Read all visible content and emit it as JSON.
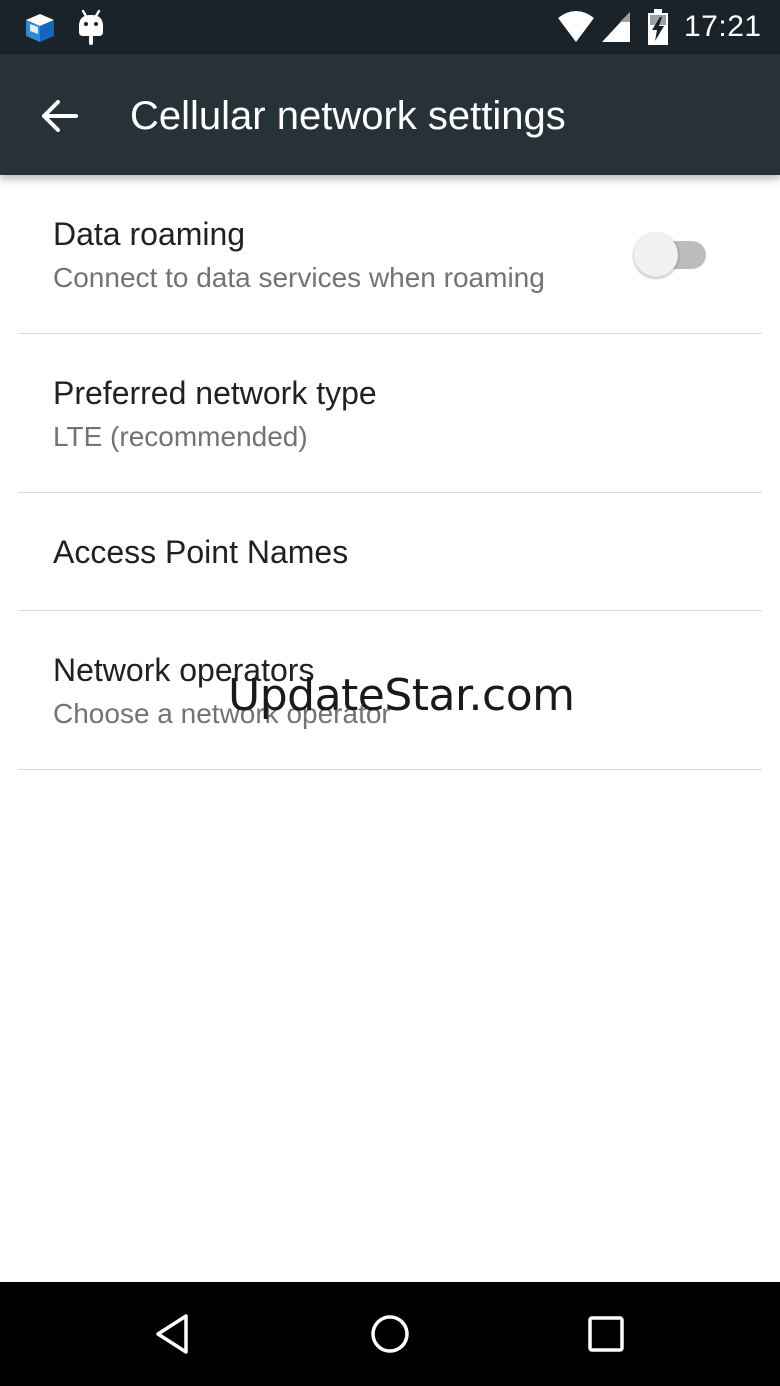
{
  "status_bar": {
    "time": "17:21",
    "icons": [
      "app-notification-icon",
      "android-debug-icon",
      "wifi-icon",
      "cell-signal-icon",
      "battery-charging-icon"
    ]
  },
  "app_bar": {
    "title": "Cellular network settings",
    "back_icon": "arrow-back-icon"
  },
  "settings": {
    "data_roaming": {
      "title": "Data roaming",
      "summary": "Connect to data services when roaming",
      "enabled": false
    },
    "preferred_network": {
      "title": "Preferred network type",
      "summary": "LTE (recommended)"
    },
    "apn": {
      "title": "Access Point Names"
    },
    "network_operators": {
      "title": "Network operators",
      "summary": "Choose a network operator"
    }
  },
  "watermark": "UpdateStar.com",
  "nav_bar": {
    "icons": [
      "nav-back-icon",
      "nav-home-icon",
      "nav-recents-icon"
    ]
  },
  "colors": {
    "status_bar": "#1a2329",
    "app_bar": "#263238",
    "title_text": "#212121",
    "summary_text": "#737373",
    "divider": "#d9d9d9",
    "switch_track": "#bdbdbd",
    "switch_thumb": "#f1f1f1"
  }
}
